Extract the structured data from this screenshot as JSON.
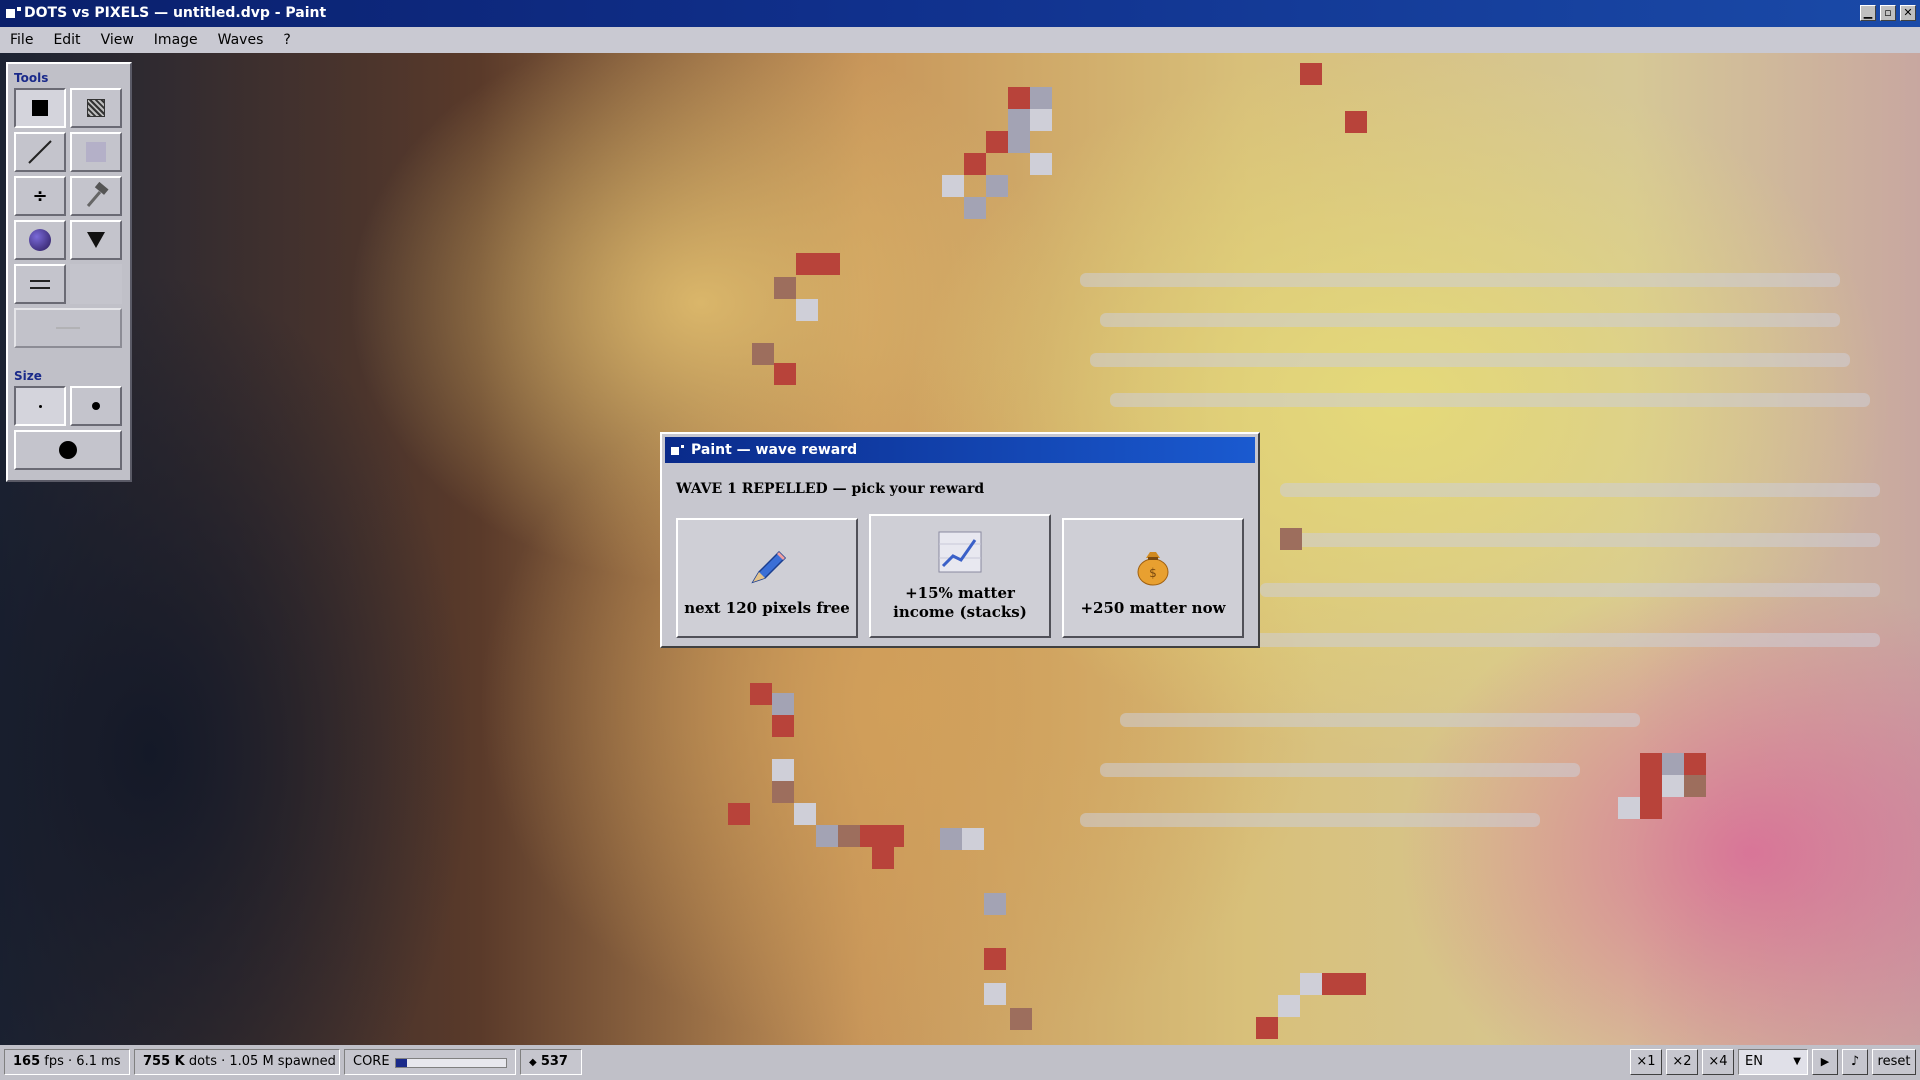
{
  "window": {
    "title": "DOTS vs PIXELS — untitled.dvp - Paint"
  },
  "menu": [
    "File",
    "Edit",
    "View",
    "Image",
    "Waves",
    "?"
  ],
  "tools_panel": {
    "tools_label": "Tools",
    "size_label": "Size",
    "tools": [
      {
        "name": "solid-pixel-tool-icon"
      },
      {
        "name": "mesh-pixel-tool-icon"
      },
      {
        "name": "line-tool-icon"
      },
      {
        "name": "ghost-pixel-tool-icon"
      },
      {
        "name": "split-tool-icon"
      },
      {
        "name": "hammer-tool-icon"
      },
      {
        "name": "bomb-tool-icon"
      },
      {
        "name": "funnel-tool-icon"
      },
      {
        "name": "double-line-tool-icon"
      },
      {
        "name": "empty-slot"
      },
      {
        "name": "disabled-tool"
      }
    ],
    "sizes": [
      "small",
      "medium",
      "large"
    ]
  },
  "dialog": {
    "title": "Paint — wave reward",
    "heading": "WAVE 1 REPELLED — pick your reward",
    "rewards": [
      {
        "label": "next 120 pixels free",
        "icon": "pencil-icon"
      },
      {
        "label": "+15% matter income (stacks)",
        "icon": "chart-icon"
      },
      {
        "label": "+250 matter now",
        "icon": "money-bag-icon"
      }
    ]
  },
  "status": {
    "fps": "165",
    "fps_unit": "fps",
    "ms": "6.1 ms",
    "dots_count": "755 K",
    "dots_unit": "dots",
    "spawned": "1.05 M spawned",
    "core_label": "CORE",
    "core_fraction": 0.1,
    "matter_icon": "diamond-icon",
    "matter": "537",
    "speed_buttons": [
      "×1",
      "×2",
      "×4"
    ],
    "language": "EN",
    "play_icon": "play-icon",
    "music_icon": "music-note-icon",
    "reset_label": "reset"
  }
}
